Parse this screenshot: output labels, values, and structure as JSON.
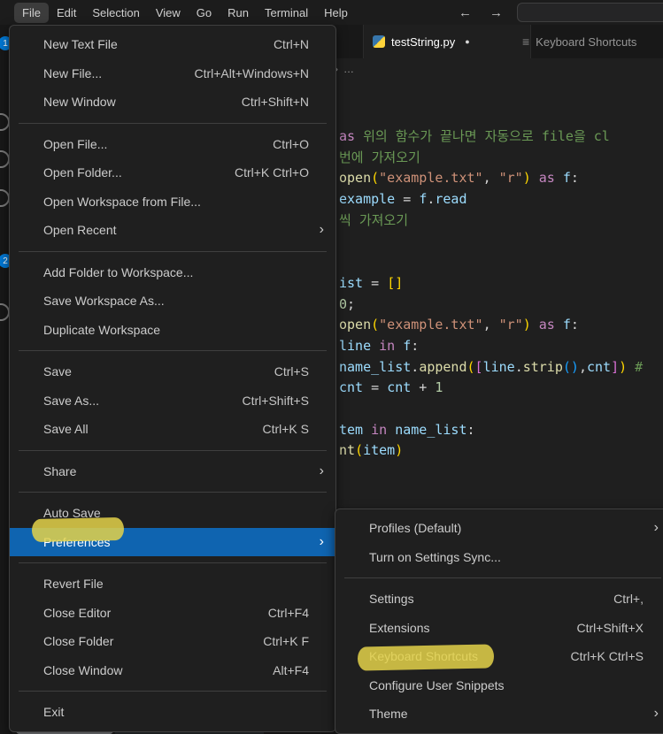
{
  "icons": {
    "chevron_right": "›",
    "back_arrow": "←",
    "forward_arrow": "→",
    "breadcrumb_chevron": "›",
    "breadcrumb_ellipsis": "…",
    "modified_dot": "●",
    "keybindings": "≡"
  },
  "colors": {
    "selection_blue": "#0f64b0",
    "highlighter_yellow": "#e4d24a",
    "badge_blue": "#0078d4"
  },
  "titlebar": {
    "menus": [
      "File",
      "Edit",
      "Selection",
      "View",
      "Go",
      "Run",
      "Terminal",
      "Help"
    ]
  },
  "activity": {
    "badge1": "1",
    "badge2": "2"
  },
  "tabs": {
    "tab1": {
      "label": "testString.py",
      "modified": true
    },
    "tab2": {
      "label": "Keyboard Shortcuts"
    }
  },
  "file_menu": {
    "items": [
      {
        "label": "New Text File",
        "shortcut": "Ctrl+N"
      },
      {
        "label": "New File...",
        "shortcut": "Ctrl+Alt+Windows+N"
      },
      {
        "label": "New Window",
        "shortcut": "Ctrl+Shift+N"
      },
      {
        "label": "Open File...",
        "shortcut": "Ctrl+O"
      },
      {
        "label": "Open Folder...",
        "shortcut": "Ctrl+K Ctrl+O"
      },
      {
        "label": "Open Workspace from File..."
      },
      {
        "label": "Open Recent",
        "submenu": true
      },
      {
        "label": "Add Folder to Workspace..."
      },
      {
        "label": "Save Workspace As..."
      },
      {
        "label": "Duplicate Workspace"
      },
      {
        "label": "Save",
        "shortcut": "Ctrl+S"
      },
      {
        "label": "Save As...",
        "shortcut": "Ctrl+Shift+S"
      },
      {
        "label": "Save All",
        "shortcut": "Ctrl+K S"
      },
      {
        "label": "Share",
        "submenu": true
      },
      {
        "label": "Auto Save"
      },
      {
        "label": "Preferences",
        "submenu": true,
        "selected": true
      },
      {
        "label": "Revert File"
      },
      {
        "label": "Close Editor",
        "shortcut": "Ctrl+F4"
      },
      {
        "label": "Close Folder",
        "shortcut": "Ctrl+K F"
      },
      {
        "label": "Close Window",
        "shortcut": "Alt+F4"
      },
      {
        "label": "Exit"
      }
    ]
  },
  "pref_menu": {
    "items": [
      {
        "label": "Profiles (Default)",
        "submenu": true
      },
      {
        "label": "Turn on Settings Sync..."
      },
      {
        "label": "Settings",
        "shortcut": "Ctrl+,"
      },
      {
        "label": "Extensions",
        "shortcut": "Ctrl+Shift+X"
      },
      {
        "label": "Keyboard Shortcuts",
        "shortcut": "Ctrl+K Ctrl+S",
        "marked": true
      },
      {
        "label": "Configure User Snippets"
      },
      {
        "label": "Theme",
        "submenu": true
      }
    ]
  },
  "editor": {
    "lines": [
      {
        "tokens": [
          {
            "t": "as ",
            "c": "kw"
          },
          {
            "t": "위의 함수가 끝나면 자동으로 file을 cl",
            "c": "com"
          }
        ]
      },
      {
        "tokens": [
          {
            "t": "번에 가져오기",
            "c": "com"
          }
        ]
      },
      {
        "tokens": [
          {
            "t": "open",
            "c": "fn"
          },
          {
            "t": "(",
            "c": "br1"
          },
          {
            "t": "\"example.txt\"",
            "c": "str"
          },
          {
            "t": ", ",
            "c": "pln"
          },
          {
            "t": "\"r\"",
            "c": "str"
          },
          {
            "t": ")",
            "c": "br1"
          },
          {
            "t": " as ",
            "c": "kw"
          },
          {
            "t": "f",
            "c": "var"
          },
          {
            "t": ":",
            "c": "pln"
          }
        ]
      },
      {
        "tokens": [
          {
            "t": "example",
            "c": "var"
          },
          {
            "t": " = ",
            "c": "pln"
          },
          {
            "t": "f",
            "c": "var"
          },
          {
            "t": ".",
            "c": "pln"
          },
          {
            "t": "read",
            "c": "var"
          }
        ]
      },
      {
        "tokens": [
          {
            "t": "씩 가져오기",
            "c": "com"
          }
        ]
      },
      {
        "tokens": []
      },
      {
        "tokens": []
      },
      {
        "tokens": [
          {
            "t": "ist",
            "c": "var"
          },
          {
            "t": " = ",
            "c": "pln"
          },
          {
            "t": "[]",
            "c": "br1"
          }
        ]
      },
      {
        "tokens": [
          {
            "t": "0",
            "c": "num"
          },
          {
            "t": ";",
            "c": "pln"
          }
        ]
      },
      {
        "tokens": [
          {
            "t": "open",
            "c": "fn"
          },
          {
            "t": "(",
            "c": "br1"
          },
          {
            "t": "\"example.txt\"",
            "c": "str"
          },
          {
            "t": ", ",
            "c": "pln"
          },
          {
            "t": "\"r\"",
            "c": "str"
          },
          {
            "t": ")",
            "c": "br1"
          },
          {
            "t": " as ",
            "c": "kw"
          },
          {
            "t": "f",
            "c": "var"
          },
          {
            "t": ":",
            "c": "pln"
          }
        ]
      },
      {
        "tokens": [
          {
            "t": "line",
            "c": "var"
          },
          {
            "t": " in ",
            "c": "kw"
          },
          {
            "t": "f",
            "c": "var"
          },
          {
            "t": ":",
            "c": "pln"
          }
        ]
      },
      {
        "tokens": [
          {
            "t": "name_list",
            "c": "var"
          },
          {
            "t": ".",
            "c": "pln"
          },
          {
            "t": "append",
            "c": "fn"
          },
          {
            "t": "(",
            "c": "br1"
          },
          {
            "t": "[",
            "c": "br2"
          },
          {
            "t": "line",
            "c": "var"
          },
          {
            "t": ".",
            "c": "pln"
          },
          {
            "t": "strip",
            "c": "fn"
          },
          {
            "t": "()",
            "c": "br3"
          },
          {
            "t": ",",
            "c": "pln"
          },
          {
            "t": "cnt",
            "c": "var"
          },
          {
            "t": "]",
            "c": "br2"
          },
          {
            "t": ")",
            "c": "br1"
          },
          {
            "t": " #",
            "c": "com"
          }
        ]
      },
      {
        "tokens": [
          {
            "t": "cnt",
            "c": "var"
          },
          {
            "t": " = ",
            "c": "pln"
          },
          {
            "t": "cnt",
            "c": "var"
          },
          {
            "t": " + ",
            "c": "pln"
          },
          {
            "t": "1",
            "c": "num"
          }
        ]
      },
      {
        "tokens": []
      },
      {
        "tokens": [
          {
            "t": "tem ",
            "c": "var"
          },
          {
            "t": "in",
            "c": "kw"
          },
          {
            "t": " name_list",
            "c": "var"
          },
          {
            "t": ":",
            "c": "pln"
          }
        ]
      },
      {
        "tokens": [
          {
            "t": "nt",
            "c": "fn"
          },
          {
            "t": "(",
            "c": "br1"
          },
          {
            "t": "item",
            "c": "var"
          },
          {
            "t": ")",
            "c": "br1"
          }
        ]
      }
    ]
  }
}
